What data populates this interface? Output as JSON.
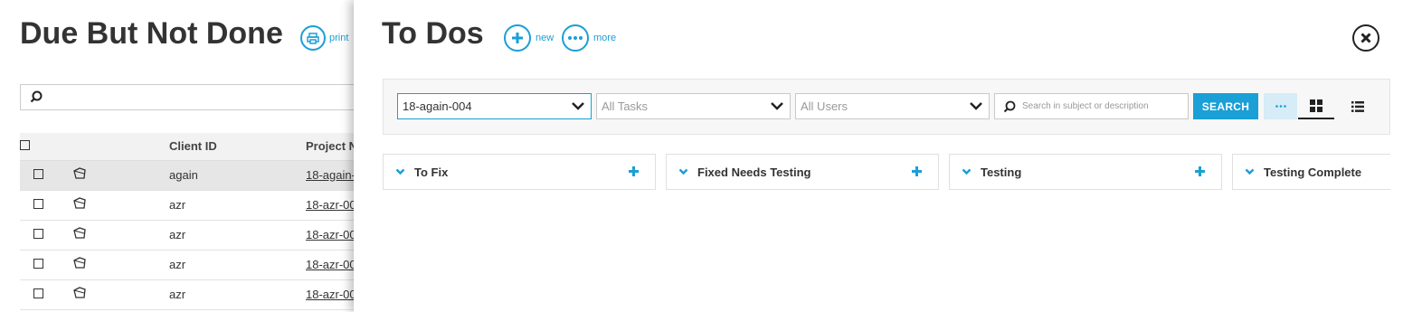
{
  "background": {
    "title": "Due But Not Done",
    "print_label": "print",
    "table": {
      "headers": {
        "client": "Client ID",
        "project": "Project N"
      },
      "rows": [
        {
          "client": "again",
          "project": "18-again-0",
          "selected": true
        },
        {
          "client": "azr",
          "project": "18-azr-00",
          "selected": false
        },
        {
          "client": "azr",
          "project": "18-azr-00",
          "selected": false
        },
        {
          "client": "azr",
          "project": "18-azr-00",
          "selected": false
        },
        {
          "client": "azr",
          "project": "18-azr-00",
          "selected": false
        }
      ]
    }
  },
  "panel": {
    "title": "To Dos",
    "new_label": "new",
    "more_label": "more",
    "filters": {
      "project": "18-again-004",
      "tasks": "All Tasks",
      "users": "All Users",
      "search_placeholder": "Search in subject or description",
      "search_button": "SEARCH",
      "dots": "•••"
    },
    "columns": [
      {
        "name": "To Fix",
        "addable": true
      },
      {
        "name": "Fixed Needs Testing",
        "addable": true
      },
      {
        "name": "Testing",
        "addable": true
      },
      {
        "name": "Testing Complete",
        "addable": false
      }
    ]
  },
  "colors": {
    "accent": "#1a9fd6",
    "dark": "#333333"
  },
  "icons": [
    "printer-icon",
    "search-icon",
    "tag-icon",
    "plus-icon",
    "more-icon",
    "close-icon",
    "chevron-down-icon",
    "grid-view-icon",
    "list-view-icon"
  ]
}
